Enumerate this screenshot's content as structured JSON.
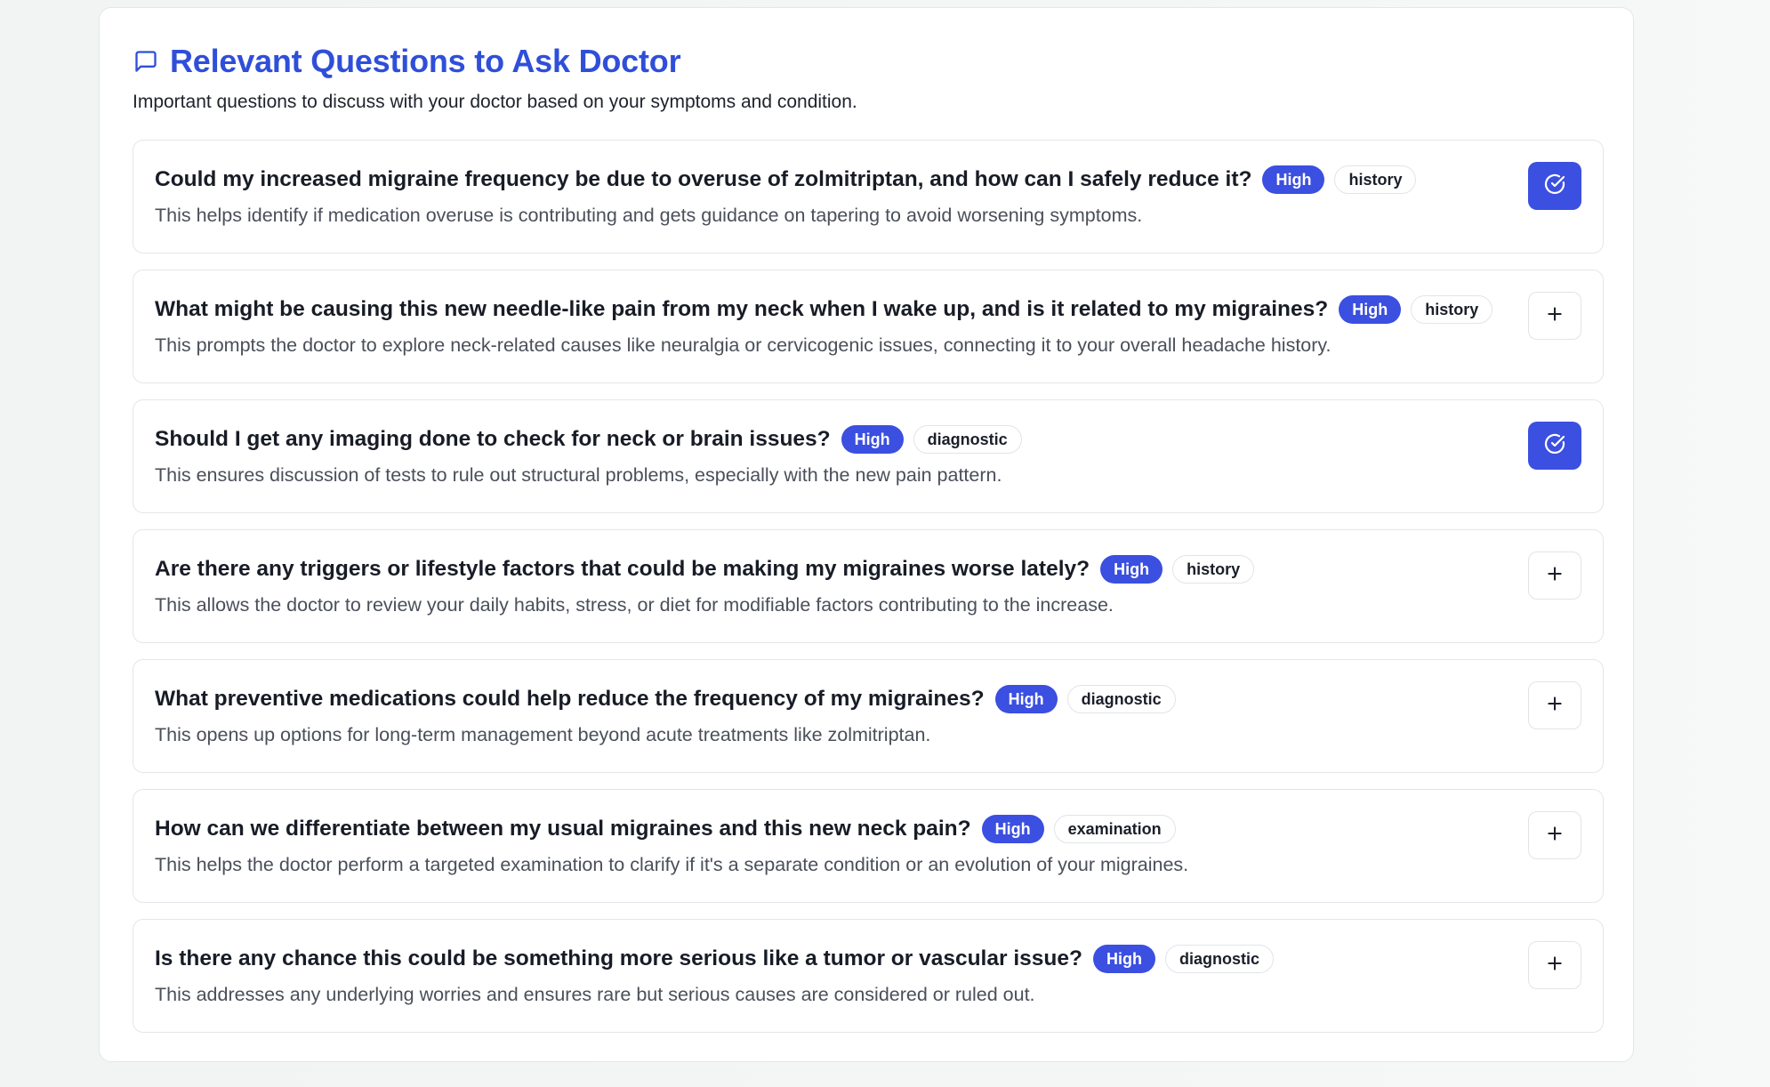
{
  "header": {
    "icon": "chat-bubble-icon",
    "title": "Relevant Questions to Ask Doctor",
    "subtitle": "Important questions to discuss with your doctor based on your symptoms and condition."
  },
  "colors": {
    "accent": "#3b4fe0",
    "title": "#2f4fd9"
  },
  "questions": [
    {
      "question": "Could my increased migraine frequency be due to overuse of zolmitriptan, and how can I safely reduce it?",
      "priority": "High",
      "category": "history",
      "description": "This helps identify if medication overuse is contributing and gets guidance on tapering to avoid worsening symptoms.",
      "selected": true
    },
    {
      "question": "What might be causing this new needle-like pain from my neck when I wake up, and is it related to my migraines?",
      "priority": "High",
      "category": "history",
      "description": "This prompts the doctor to explore neck-related causes like neuralgia or cervicogenic issues, connecting it to your overall headache history.",
      "selected": false
    },
    {
      "question": "Should I get any imaging done to check for neck or brain issues?",
      "priority": "High",
      "category": "diagnostic",
      "description": "This ensures discussion of tests to rule out structural problems, especially with the new pain pattern.",
      "selected": true
    },
    {
      "question": "Are there any triggers or lifestyle factors that could be making my migraines worse lately?",
      "priority": "High",
      "category": "history",
      "description": "This allows the doctor to review your daily habits, stress, or diet for modifiable factors contributing to the increase.",
      "selected": false
    },
    {
      "question": "What preventive medications could help reduce the frequency of my migraines?",
      "priority": "High",
      "category": "diagnostic",
      "description": "This opens up options for long-term management beyond acute treatments like zolmitriptan.",
      "selected": false
    },
    {
      "question": "How can we differentiate between my usual migraines and this new neck pain?",
      "priority": "High",
      "category": "examination",
      "description": "This helps the doctor perform a targeted examination to clarify if it's a separate condition or an evolution of your migraines.",
      "selected": false
    },
    {
      "question": "Is there any chance this could be something more serious like a tumor or vascular issue?",
      "priority": "High",
      "category": "diagnostic",
      "description": "This addresses any underlying worries and ensures rare but serious causes are considered or ruled out.",
      "selected": false
    }
  ]
}
